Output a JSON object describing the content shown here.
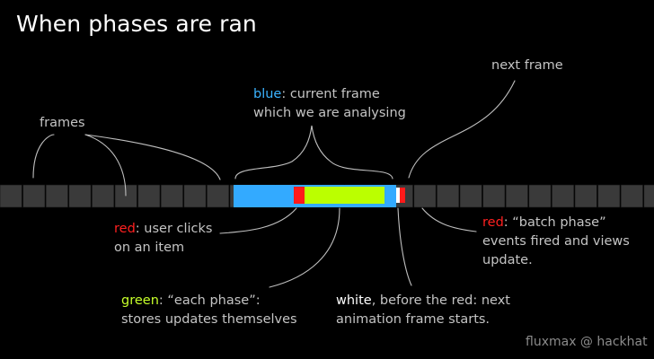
{
  "title": "When phases are ran",
  "labels": {
    "frames": "frames",
    "next_frame": "next frame",
    "blue": {
      "keyword": "blue",
      "line1_rest": ": current frame",
      "line2": "which we are analysing"
    },
    "red_click": {
      "keyword": "red",
      "line1_rest": ": user clicks",
      "line2": "on an item"
    },
    "red_batch": {
      "keyword": "red",
      "line1_rest": ": “batch phase”",
      "line2": "events fired and views",
      "line3": "update."
    },
    "green": {
      "keyword": "green",
      "line1_rest": ": “each phase”:",
      "line2": "stores updates themselves"
    },
    "white": {
      "keyword": "white",
      "line1_rest": ", before the red: next",
      "line2": "animation frame starts."
    }
  },
  "credit": "fluxmax @ hackhat",
  "colors": {
    "background": "#000000",
    "frame_cell": "#3a3a3a",
    "frame_border": "#111111",
    "current_frame": "#33aaff",
    "each_phase": "#bbff00",
    "user_click": "#ff1a1a",
    "batch_phase": "#ff1a1a",
    "next_frame_start": "#ffffff",
    "leader_line": "#bfbfbf"
  }
}
